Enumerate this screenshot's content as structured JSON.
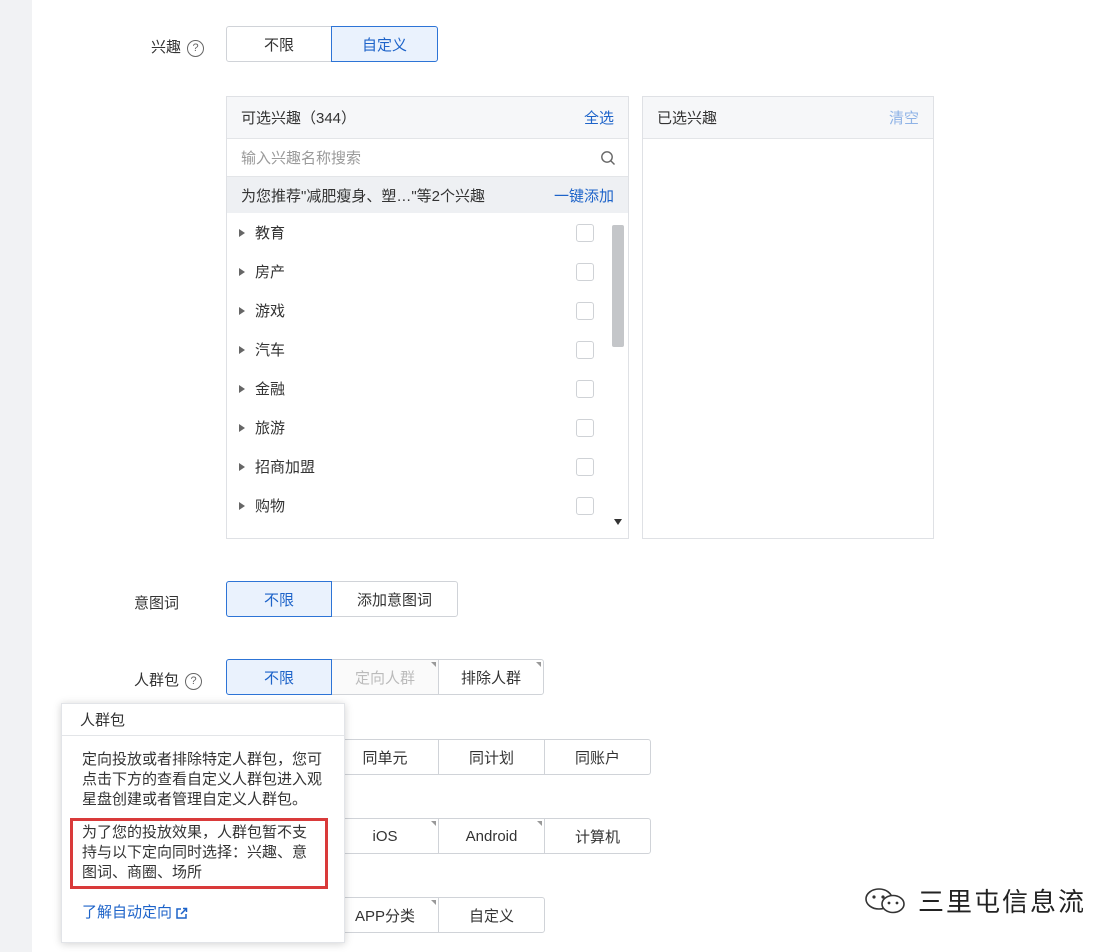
{
  "interest": {
    "label": "兴趣",
    "help_glyph": "?",
    "options": [
      "不限",
      "自定义"
    ],
    "selected": "自定义"
  },
  "available_panel": {
    "title": "可选兴趣（344）",
    "select_all": "全选",
    "search_placeholder": "输入兴趣名称搜索",
    "recommend_text": "为您推荐\"减肥瘦身、塑…\"等2个兴趣",
    "recommend_action": "一键添加",
    "items": [
      {
        "label": "教育"
      },
      {
        "label": "房产"
      },
      {
        "label": "游戏"
      },
      {
        "label": "汽车"
      },
      {
        "label": "金融"
      },
      {
        "label": "旅游"
      },
      {
        "label": "招商加盟"
      },
      {
        "label": "购物"
      }
    ]
  },
  "selected_panel": {
    "title": "已选兴趣",
    "clear": "清空"
  },
  "intent_words": {
    "label": "意图词",
    "options": [
      "不限",
      "添加意图词"
    ],
    "selected": "不限"
  },
  "audience": {
    "label": "人群包",
    "help_glyph": "?",
    "options": [
      "不限",
      "定向人群",
      "排除人群"
    ],
    "selected": "不限",
    "row2_options": [
      "同单元",
      "同计划",
      "同账户"
    ],
    "row3_options": [
      "iOS",
      "Android",
      "计算机"
    ],
    "row4_options": [
      "APP分类",
      "自定义"
    ]
  },
  "popover": {
    "title": "人群包",
    "paragraph": "定向投放或者排除特定人群包，您可点击下方的查看自定义人群包进入观星盘创建或者管理自定义人群包。",
    "warning": "为了您的投放效果，人群包暂不支持与以下定向同时选择：兴趣、意图词、商圈、场所",
    "link": "了解自动定向"
  },
  "watermark": {
    "text": "三里屯信息流"
  },
  "colors": {
    "accent": "#1d63c9",
    "active_bg": "#eaf2fd",
    "warning_border": "#d93a3a"
  }
}
